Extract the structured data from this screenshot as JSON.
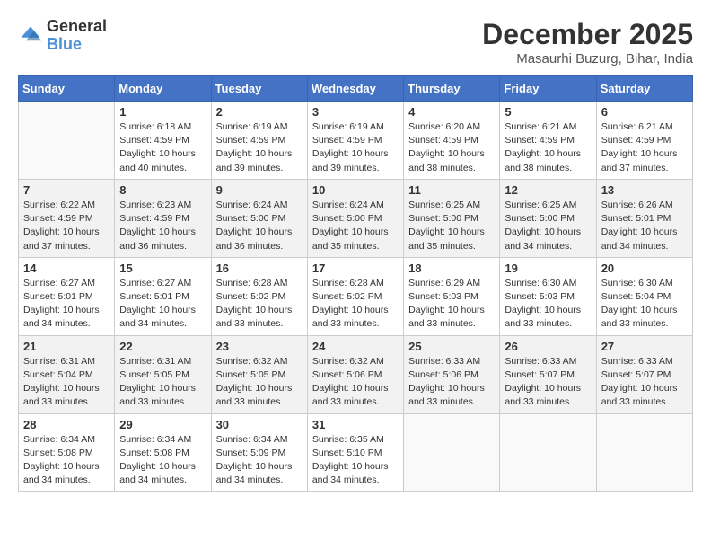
{
  "header": {
    "logo_general": "General",
    "logo_blue": "Blue",
    "month_title": "December 2025",
    "location": "Masaurhi Buzurg, Bihar, India"
  },
  "days_of_week": [
    "Sunday",
    "Monday",
    "Tuesday",
    "Wednesday",
    "Thursday",
    "Friday",
    "Saturday"
  ],
  "weeks": [
    [
      {
        "day": "",
        "sunrise": "",
        "sunset": "",
        "daylight": ""
      },
      {
        "day": "1",
        "sunrise": "Sunrise: 6:18 AM",
        "sunset": "Sunset: 4:59 PM",
        "daylight": "Daylight: 10 hours and 40 minutes."
      },
      {
        "day": "2",
        "sunrise": "Sunrise: 6:19 AM",
        "sunset": "Sunset: 4:59 PM",
        "daylight": "Daylight: 10 hours and 39 minutes."
      },
      {
        "day": "3",
        "sunrise": "Sunrise: 6:19 AM",
        "sunset": "Sunset: 4:59 PM",
        "daylight": "Daylight: 10 hours and 39 minutes."
      },
      {
        "day": "4",
        "sunrise": "Sunrise: 6:20 AM",
        "sunset": "Sunset: 4:59 PM",
        "daylight": "Daylight: 10 hours and 38 minutes."
      },
      {
        "day": "5",
        "sunrise": "Sunrise: 6:21 AM",
        "sunset": "Sunset: 4:59 PM",
        "daylight": "Daylight: 10 hours and 38 minutes."
      },
      {
        "day": "6",
        "sunrise": "Sunrise: 6:21 AM",
        "sunset": "Sunset: 4:59 PM",
        "daylight": "Daylight: 10 hours and 37 minutes."
      }
    ],
    [
      {
        "day": "7",
        "sunrise": "Sunrise: 6:22 AM",
        "sunset": "Sunset: 4:59 PM",
        "daylight": "Daylight: 10 hours and 37 minutes."
      },
      {
        "day": "8",
        "sunrise": "Sunrise: 6:23 AM",
        "sunset": "Sunset: 4:59 PM",
        "daylight": "Daylight: 10 hours and 36 minutes."
      },
      {
        "day": "9",
        "sunrise": "Sunrise: 6:24 AM",
        "sunset": "Sunset: 5:00 PM",
        "daylight": "Daylight: 10 hours and 36 minutes."
      },
      {
        "day": "10",
        "sunrise": "Sunrise: 6:24 AM",
        "sunset": "Sunset: 5:00 PM",
        "daylight": "Daylight: 10 hours and 35 minutes."
      },
      {
        "day": "11",
        "sunrise": "Sunrise: 6:25 AM",
        "sunset": "Sunset: 5:00 PM",
        "daylight": "Daylight: 10 hours and 35 minutes."
      },
      {
        "day": "12",
        "sunrise": "Sunrise: 6:25 AM",
        "sunset": "Sunset: 5:00 PM",
        "daylight": "Daylight: 10 hours and 34 minutes."
      },
      {
        "day": "13",
        "sunrise": "Sunrise: 6:26 AM",
        "sunset": "Sunset: 5:01 PM",
        "daylight": "Daylight: 10 hours and 34 minutes."
      }
    ],
    [
      {
        "day": "14",
        "sunrise": "Sunrise: 6:27 AM",
        "sunset": "Sunset: 5:01 PM",
        "daylight": "Daylight: 10 hours and 34 minutes."
      },
      {
        "day": "15",
        "sunrise": "Sunrise: 6:27 AM",
        "sunset": "Sunset: 5:01 PM",
        "daylight": "Daylight: 10 hours and 34 minutes."
      },
      {
        "day": "16",
        "sunrise": "Sunrise: 6:28 AM",
        "sunset": "Sunset: 5:02 PM",
        "daylight": "Daylight: 10 hours and 33 minutes."
      },
      {
        "day": "17",
        "sunrise": "Sunrise: 6:28 AM",
        "sunset": "Sunset: 5:02 PM",
        "daylight": "Daylight: 10 hours and 33 minutes."
      },
      {
        "day": "18",
        "sunrise": "Sunrise: 6:29 AM",
        "sunset": "Sunset: 5:03 PM",
        "daylight": "Daylight: 10 hours and 33 minutes."
      },
      {
        "day": "19",
        "sunrise": "Sunrise: 6:30 AM",
        "sunset": "Sunset: 5:03 PM",
        "daylight": "Daylight: 10 hours and 33 minutes."
      },
      {
        "day": "20",
        "sunrise": "Sunrise: 6:30 AM",
        "sunset": "Sunset: 5:04 PM",
        "daylight": "Daylight: 10 hours and 33 minutes."
      }
    ],
    [
      {
        "day": "21",
        "sunrise": "Sunrise: 6:31 AM",
        "sunset": "Sunset: 5:04 PM",
        "daylight": "Daylight: 10 hours and 33 minutes."
      },
      {
        "day": "22",
        "sunrise": "Sunrise: 6:31 AM",
        "sunset": "Sunset: 5:05 PM",
        "daylight": "Daylight: 10 hours and 33 minutes."
      },
      {
        "day": "23",
        "sunrise": "Sunrise: 6:32 AM",
        "sunset": "Sunset: 5:05 PM",
        "daylight": "Daylight: 10 hours and 33 minutes."
      },
      {
        "day": "24",
        "sunrise": "Sunrise: 6:32 AM",
        "sunset": "Sunset: 5:06 PM",
        "daylight": "Daylight: 10 hours and 33 minutes."
      },
      {
        "day": "25",
        "sunrise": "Sunrise: 6:33 AM",
        "sunset": "Sunset: 5:06 PM",
        "daylight": "Daylight: 10 hours and 33 minutes."
      },
      {
        "day": "26",
        "sunrise": "Sunrise: 6:33 AM",
        "sunset": "Sunset: 5:07 PM",
        "daylight": "Daylight: 10 hours and 33 minutes."
      },
      {
        "day": "27",
        "sunrise": "Sunrise: 6:33 AM",
        "sunset": "Sunset: 5:07 PM",
        "daylight": "Daylight: 10 hours and 33 minutes."
      }
    ],
    [
      {
        "day": "28",
        "sunrise": "Sunrise: 6:34 AM",
        "sunset": "Sunset: 5:08 PM",
        "daylight": "Daylight: 10 hours and 34 minutes."
      },
      {
        "day": "29",
        "sunrise": "Sunrise: 6:34 AM",
        "sunset": "Sunset: 5:08 PM",
        "daylight": "Daylight: 10 hours and 34 minutes."
      },
      {
        "day": "30",
        "sunrise": "Sunrise: 6:34 AM",
        "sunset": "Sunset: 5:09 PM",
        "daylight": "Daylight: 10 hours and 34 minutes."
      },
      {
        "day": "31",
        "sunrise": "Sunrise: 6:35 AM",
        "sunset": "Sunset: 5:10 PM",
        "daylight": "Daylight: 10 hours and 34 minutes."
      },
      {
        "day": "",
        "sunrise": "",
        "sunset": "",
        "daylight": ""
      },
      {
        "day": "",
        "sunrise": "",
        "sunset": "",
        "daylight": ""
      },
      {
        "day": "",
        "sunrise": "",
        "sunset": "",
        "daylight": ""
      }
    ]
  ]
}
